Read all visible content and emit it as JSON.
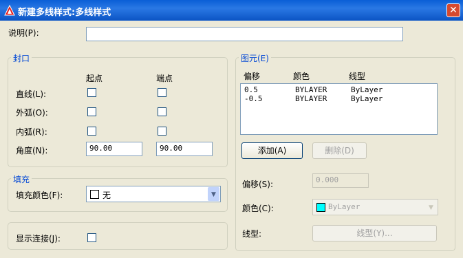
{
  "titlebar": {
    "title": "新建多线样式:多线样式",
    "close_glyph": "✕"
  },
  "description": {
    "label": "说明(P):",
    "value": ""
  },
  "caps": {
    "title": "封口",
    "col_start": "起点",
    "col_end": "端点",
    "line_label": "直线(L):",
    "outer_arc_label": "外弧(O):",
    "inner_arc_label": "内弧(R):",
    "angle_label": "角度(N):",
    "angle_start": "90.00",
    "angle_end": "90.00"
  },
  "fill": {
    "title": "填充",
    "color_label": "填充颜色(F):",
    "color_value": "无"
  },
  "show_joints": {
    "label": "显示连接(J):"
  },
  "elements": {
    "title": "图元(E)",
    "headers": [
      "偏移",
      "颜色",
      "线型"
    ],
    "rows": [
      {
        "offset": "0.5",
        "color": "BYLAYER",
        "linetype": "ByLayer"
      },
      {
        "offset": "-0.5",
        "color": "BYLAYER",
        "linetype": "ByLayer"
      }
    ],
    "add_button": "添加(A)",
    "delete_button": "删除(D)",
    "offset_label": "偏移(S):",
    "offset_value": "0.000",
    "color_label": "颜色(C):",
    "color_value": "ByLayer",
    "color_swatch": "#00ffff",
    "linetype_label": "线型:",
    "linetype_button": "线型(Y)..."
  },
  "colors": {
    "title_bar": "#0a5fd6",
    "group_title": "#0046d5",
    "close": "#d6492f"
  }
}
